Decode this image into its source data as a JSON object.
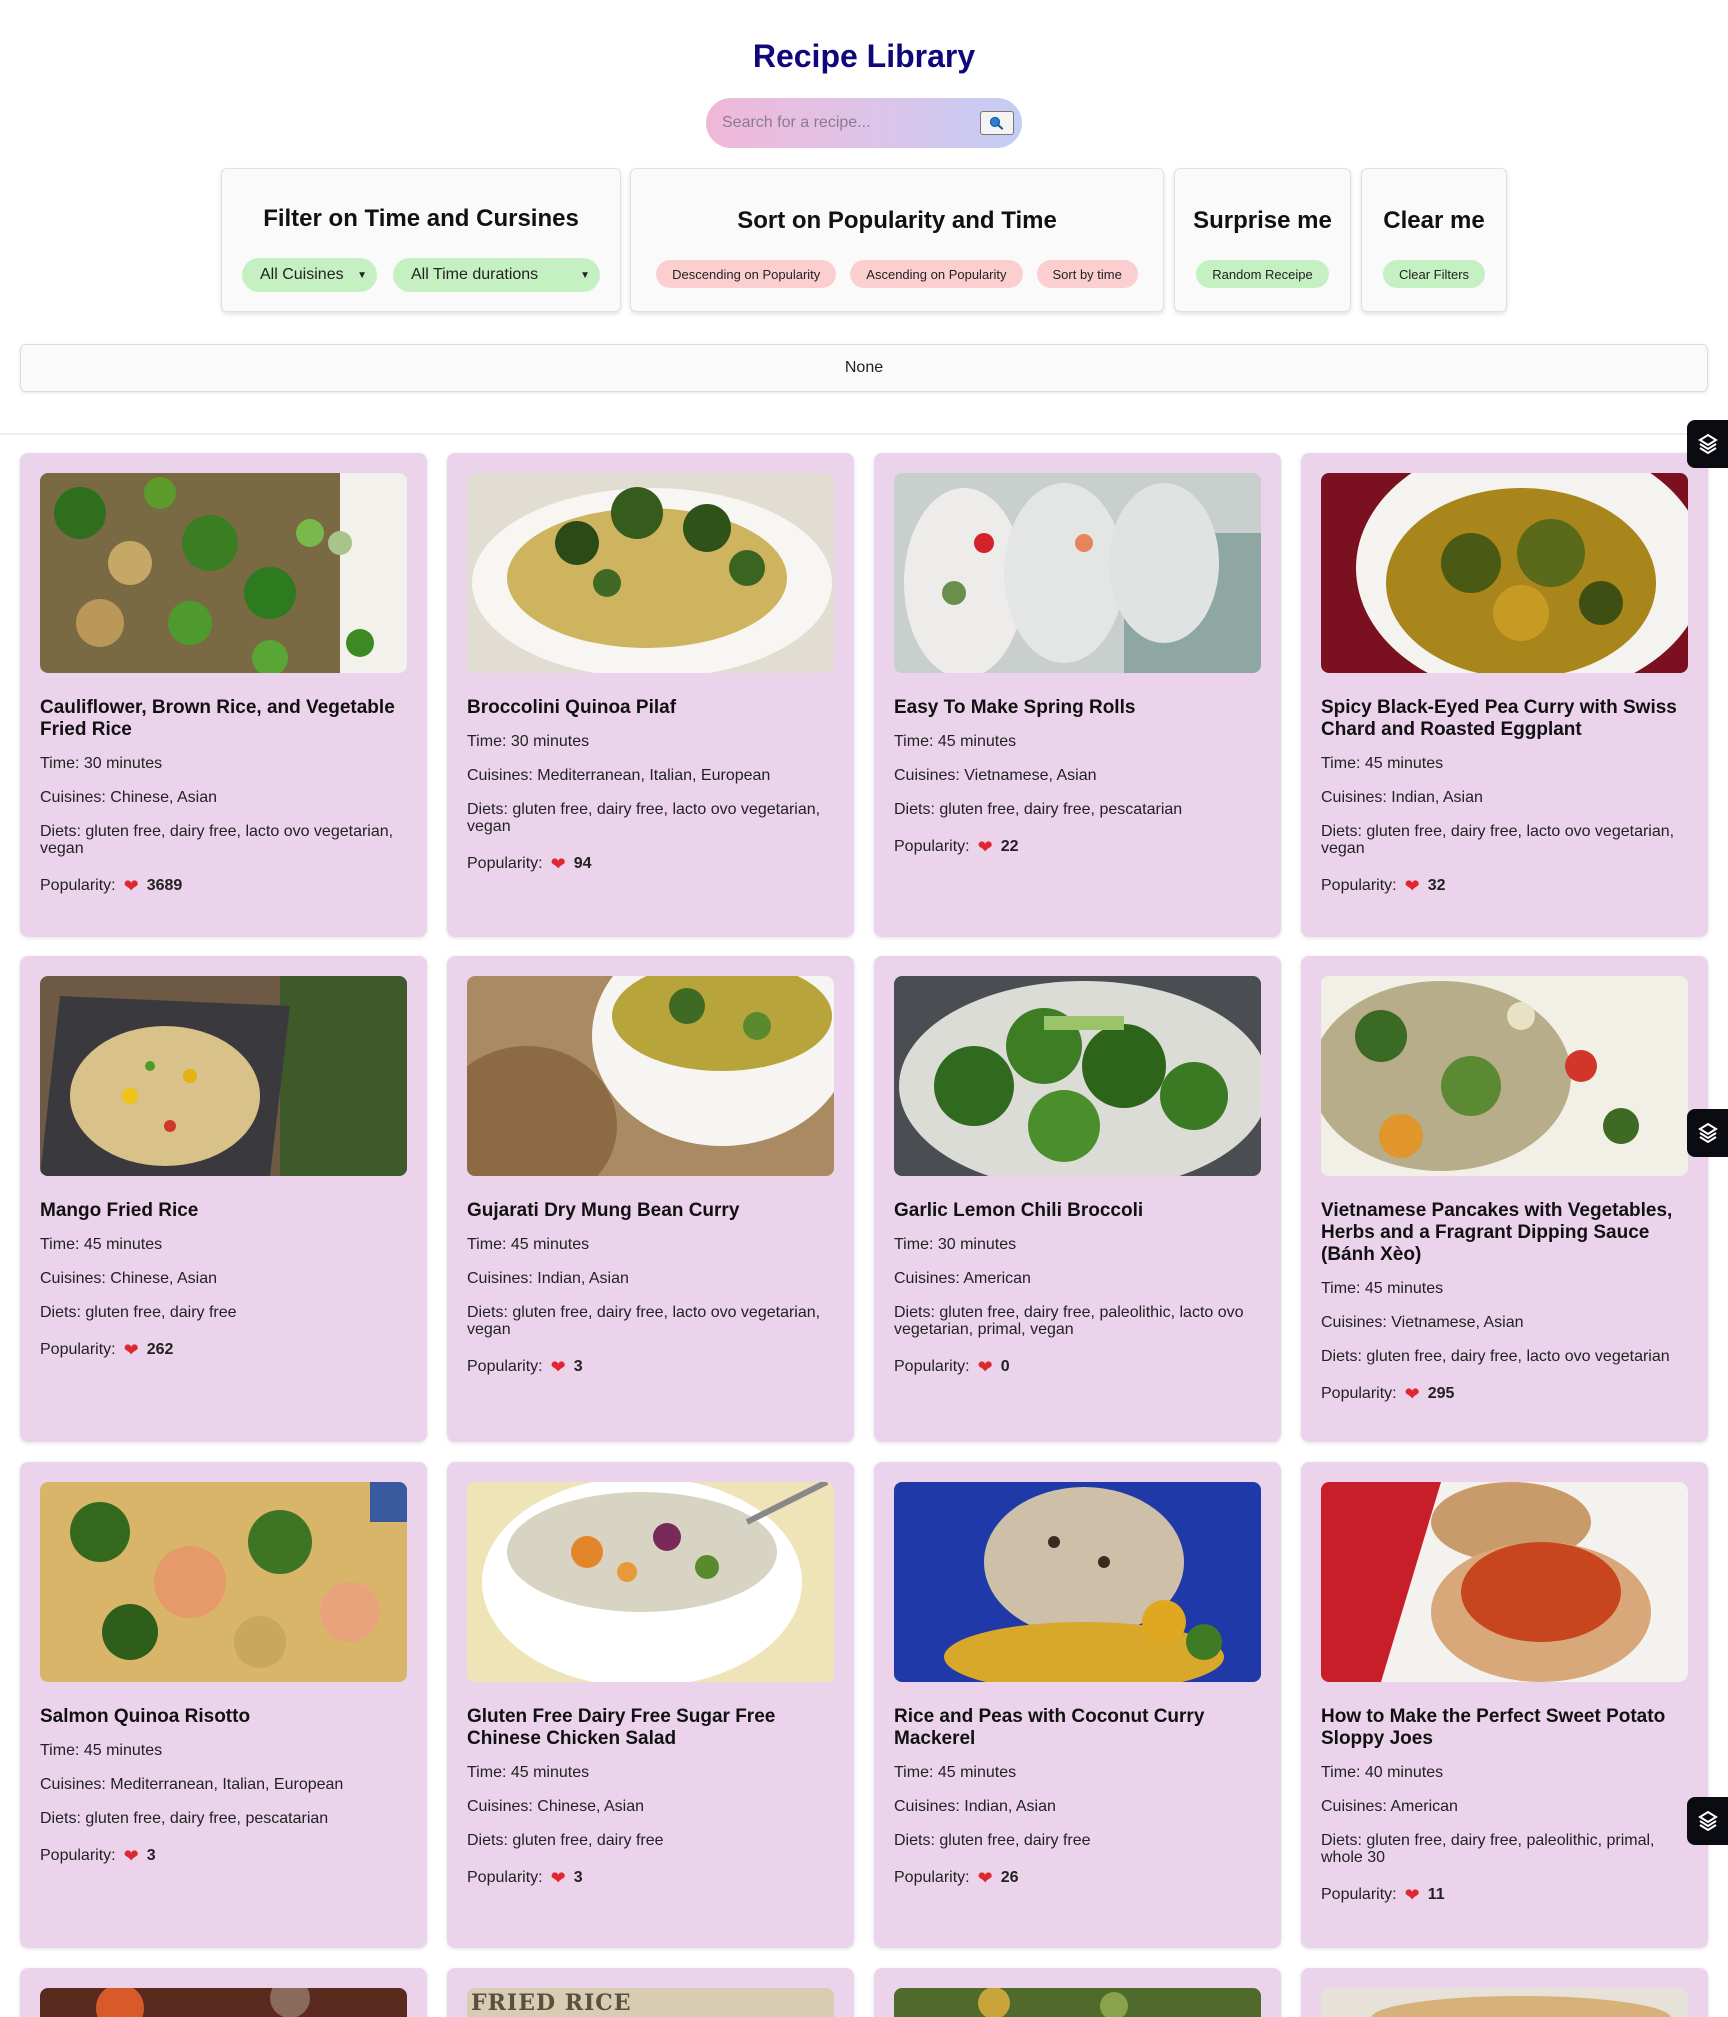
{
  "header": {
    "title": "Recipe Library",
    "search_placeholder": "Search for a recipe..."
  },
  "filter_panel": {
    "title": "Filter on Time and Cursines",
    "cuisine_select": "All Cuisines",
    "time_select": "All Time durations"
  },
  "sort_panel": {
    "title": "Sort on Popularity and Time",
    "buttons": [
      "Descending on Popularity",
      "Ascending on Popularity",
      "Sort by time"
    ]
  },
  "surprise_panel": {
    "title": "Surprise me",
    "button": "Random Receipe"
  },
  "clear_panel": {
    "title": "Clear me",
    "button": "Clear Filters"
  },
  "status": "None",
  "labels": {
    "time": "Time:",
    "cuisines": "Cuisines:",
    "diets": "Diets:",
    "popularity": "Popularity:"
  },
  "recipes": [
    {
      "title": "Cauliflower, Brown Rice, and Vegetable Fried Rice",
      "time": "30 minutes",
      "cuisines": "Chinese, Asian",
      "diets": "gluten free, dairy free, lacto ovo vegetarian, vegan",
      "popularity": "3689"
    },
    {
      "title": "Broccolini Quinoa Pilaf",
      "time": "30 minutes",
      "cuisines": "Mediterranean, Italian, European",
      "diets": "gluten free, dairy free, lacto ovo vegetarian, vegan",
      "popularity": "94"
    },
    {
      "title": "Easy To Make Spring Rolls",
      "time": "45 minutes",
      "cuisines": "Vietnamese, Asian",
      "diets": "gluten free, dairy free, pescatarian",
      "popularity": "22"
    },
    {
      "title": "Spicy Black-Eyed Pea Curry with Swiss Chard and Roasted Eggplant",
      "time": "45 minutes",
      "cuisines": "Indian, Asian",
      "diets": "gluten free, dairy free, lacto ovo vegetarian, vegan",
      "popularity": "32"
    },
    {
      "title": "Mango Fried Rice",
      "time": "45 minutes",
      "cuisines": "Chinese, Asian",
      "diets": "gluten free, dairy free",
      "popularity": "262"
    },
    {
      "title": "Gujarati Dry Mung Bean Curry",
      "time": "45 minutes",
      "cuisines": "Indian, Asian",
      "diets": "gluten free, dairy free, lacto ovo vegetarian, vegan",
      "popularity": "3"
    },
    {
      "title": "Garlic Lemon Chili Broccoli",
      "time": "30 minutes",
      "cuisines": "American",
      "diets": "gluten free, dairy free, paleolithic, lacto ovo vegetarian, primal, vegan",
      "popularity": "0"
    },
    {
      "title": "Vietnamese Pancakes with Vegetables, Herbs and a Fragrant Dipping Sauce (Bánh Xèo)",
      "time": "45 minutes",
      "cuisines": "Vietnamese, Asian",
      "diets": "gluten free, dairy free, lacto ovo vegetarian",
      "popularity": "295"
    },
    {
      "title": "Salmon Quinoa Risotto",
      "time": "45 minutes",
      "cuisines": "Mediterranean, Italian, European",
      "diets": "gluten free, dairy free, pescatarian",
      "popularity": "3"
    },
    {
      "title": "Gluten Free Dairy Free Sugar Free Chinese Chicken Salad",
      "time": "45 minutes",
      "cuisines": "Chinese, Asian",
      "diets": "gluten free, dairy free",
      "popularity": "3"
    },
    {
      "title": "Rice and Peas with Coconut Curry Mackerel",
      "time": "45 minutes",
      "cuisines": "Indian, Asian",
      "diets": "gluten free, dairy free",
      "popularity": "26"
    },
    {
      "title": "How to Make the Perfect Sweet Potato Sloppy Joes",
      "time": "40 minutes",
      "cuisines": "American",
      "diets": "gluten free, dairy free, paleolithic, primal, whole 30",
      "popularity": "11"
    }
  ],
  "partial_row_image_text": "FRIED RICE"
}
